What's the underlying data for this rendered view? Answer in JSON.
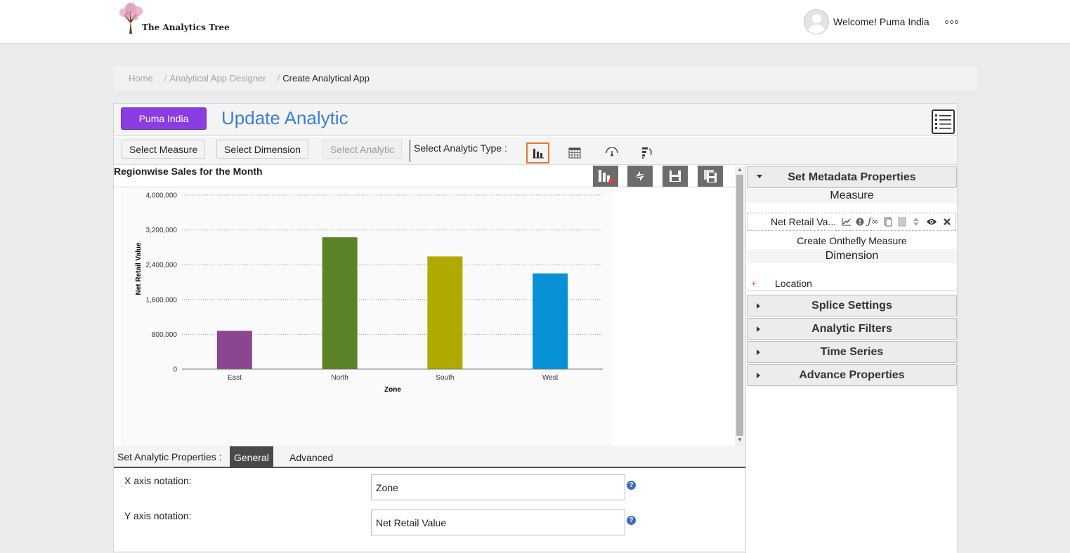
{
  "header": {
    "logo_text": "The Analytics Tree",
    "welcome": "Welcome! Puma India"
  },
  "breadcrumb": {
    "home": "Home",
    "designer": "Analytical App Designer",
    "current": "Create Analytical App"
  },
  "panel": {
    "company_button": "Puma India",
    "title": "Update Analytic"
  },
  "toolbar": {
    "select_measure": "Select Measure",
    "select_dimension": "Select Dimension",
    "select_analytic": "Select Analytic",
    "type_label": "Select Analytic Type :",
    "types": [
      "bar-chart-icon",
      "table-icon",
      "gauge-icon",
      "funnel-icon"
    ]
  },
  "chart_data": {
    "type": "bar",
    "title": "Regionwise Sales for the Month",
    "categories": [
      "East",
      "North",
      "South",
      "West"
    ],
    "values": [
      880000,
      3030000,
      2590000,
      2200000
    ],
    "colors": [
      "#8b4690",
      "#5b8226",
      "#b2a900",
      "#0892d6"
    ],
    "xlabel": "Zone",
    "ylabel": "Net Retail Value",
    "ylim": [
      0,
      4000000
    ],
    "yticks": [
      0,
      800000,
      1600000,
      2400000,
      3200000,
      4000000
    ],
    "ytick_labels": [
      "0",
      "800,000",
      "1,600,000",
      "2,400,000",
      "3,200,000",
      "4,000,000"
    ],
    "grid": true
  },
  "properties": {
    "label": "Set Analytic Properties :",
    "tabs": [
      "General",
      "Advanced"
    ],
    "x_label": "X axis notation:",
    "x_value": "Zone",
    "y_label": "Y axis notation:",
    "y_value": "Net Retail Value"
  },
  "right": {
    "metadata": "Set Metadata Properties",
    "measure_head": "Measure",
    "measure_name": "Net Retail Va...",
    "onthefly": "Create Onthefly Measure",
    "dimension_head": "Dimension",
    "dimension_name": "Location",
    "splice": "Splice Settings",
    "filters": "Analytic Filters",
    "timeseries": "Time Series",
    "advance": "Advance Properties"
  },
  "colors": {
    "accent_purple": "#8a3de0",
    "title_blue": "#3e7fd5",
    "active_type_border": "#e07a2f"
  }
}
